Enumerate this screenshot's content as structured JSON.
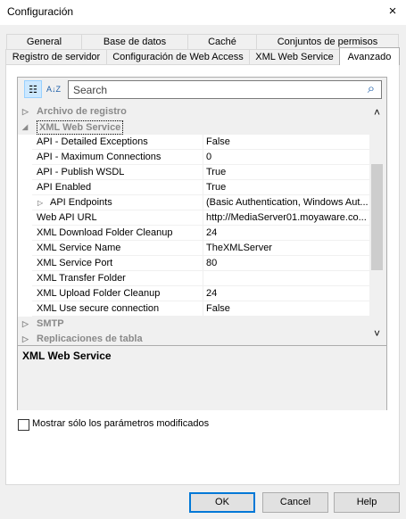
{
  "window": {
    "title": "Configuración",
    "close_icon": "×"
  },
  "tabs": {
    "row1": [
      "General",
      "Base de datos",
      "Caché",
      "Conjuntos de permisos"
    ],
    "row2": [
      "Registro de servidor",
      "Configuración de Web Access",
      "XML Web Service",
      "Avanzado"
    ]
  },
  "toolbar": {
    "categorized_icon": "☷",
    "alpha_icon": "A↓Z",
    "search_placeholder": "Search",
    "search_icon": "⌕"
  },
  "grid": {
    "cat_archivo": "Archivo de registro",
    "cat_xml": "XML Web Service",
    "properties": [
      {
        "name": "API - Detailed Exceptions",
        "value": "False"
      },
      {
        "name": "API - Maximum Connections",
        "value": "0"
      },
      {
        "name": "API - Publish WSDL",
        "value": "True"
      },
      {
        "name": "API Enabled",
        "value": "True"
      },
      {
        "name": "API Endpoints",
        "value": "(Basic Authentication, Windows Aut..."
      },
      {
        "name": "Web API URL",
        "value": "http://MediaServer01.moyaware.co..."
      },
      {
        "name": "XML Download Folder Cleanup",
        "value": "24"
      },
      {
        "name": "XML Service Name",
        "value": "TheXMLServer"
      },
      {
        "name": "XML Service Port",
        "value": "80"
      },
      {
        "name": "XML Transfer Folder",
        "value": ""
      },
      {
        "name": "XML Upload Folder Cleanup",
        "value": "24"
      },
      {
        "name": "XML Use secure connection",
        "value": "False"
      }
    ],
    "cat_smtp": "SMTP",
    "cat_replicaciones": "Replicaciones de tabla",
    "expand_icon": "▷",
    "collapse_icon": "◢"
  },
  "description": {
    "title": "XML Web Service"
  },
  "options": {
    "show_modified_label": "Mostrar sólo los parámetros modificados",
    "show_modified_checked": false
  },
  "buttons": {
    "ok": "OK",
    "cancel": "Cancel",
    "help": "Help"
  },
  "scroll": {
    "up_icon": "˄",
    "down_icon": "˅"
  }
}
